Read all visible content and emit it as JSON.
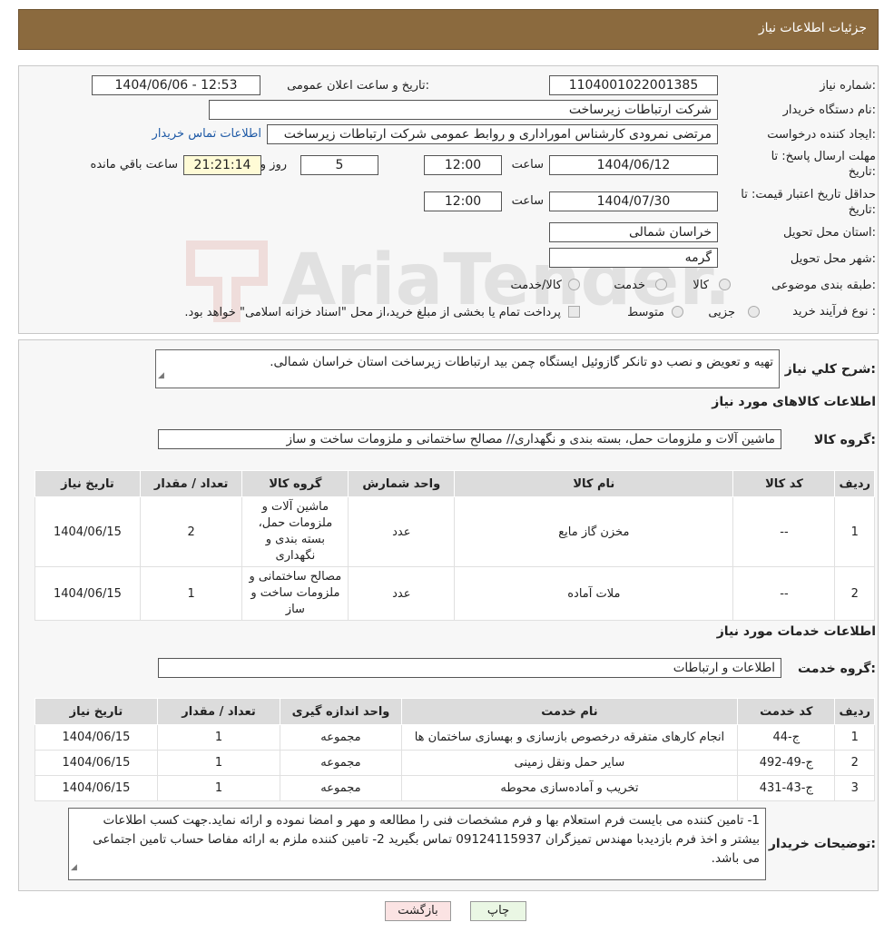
{
  "header": {
    "title": "جزئیات اطلاعات نیاز"
  },
  "need": {
    "number_label": "شماره نیاز:",
    "number": "1104001022001385",
    "announce_label": "تاریخ و ساعت اعلان عمومی:",
    "announce": "1404/06/06 - 12:53",
    "buyer_label": "نام دستگاه خریدار:",
    "buyer": "شرکت ارتباطات زیرساخت",
    "creator_label": "ایجاد کننده درخواست:",
    "creator": "مرتضی نمرودی کارشناس اموراداری و روابط عمومی شرکت ارتباطات زیرساخت",
    "contact_link": "اطلاعات تماس خریدار",
    "deadline_label_1": "مهلت ارسال پاسخ: تا",
    "deadline_label_2": "تاریخ:",
    "deadline_date": "1404/06/12",
    "time_label": "ساعت",
    "deadline_time": "12:00",
    "days": "5",
    "days_label": "روز و",
    "remaining": "21:21:14",
    "remaining_label": "ساعت باقي مانده",
    "validity_label_1": "حداقل تاریخ اعتبار قیمت: تا",
    "validity_label_2": "تاریخ:",
    "validity_date": "1404/07/30",
    "validity_time": "12:00",
    "province_label": "استان محل تحویل:",
    "province": "خراسان شمالی",
    "city_label": "شهر محل تحویل:",
    "city": "گرمه",
    "category_label": "طبقه بندی موضوعی:",
    "category_options": [
      "کالا",
      "خدمت",
      "کالا/خدمت"
    ],
    "process_label": "نوع فرآیند خرید :",
    "process_options": [
      "جزیی",
      "متوسط"
    ],
    "process_note": "پرداخت تمام یا بخشی از مبلغ خرید،از محل \"اسناد خزانه اسلامی\" خواهد بود."
  },
  "watermark": {
    "text": "AriaTender.neT"
  },
  "description": {
    "label": "شرح کلي نياز:",
    "text": "تهیه و تعویض و نصب دو تانکر گازوئیل ایستگاه چمن بید ارتباطات زیرساخت استان خراسان شمالی."
  },
  "goods": {
    "section_title": "اطلاعات کالاهای مورد نیاز",
    "group_label": "گروه کالا:",
    "group": "ماشین آلات و ملزومات حمل، بسته بندی و نگهداری// مصالح ساختمانی و ملزومات ساخت و ساز",
    "headers": [
      "ردیف",
      "کد کالا",
      "نام کالا",
      "واحد شمارش",
      "گروه کالا",
      "تعداد / مقدار",
      "تاریخ نیاز"
    ],
    "rows": [
      [
        "1",
        "--",
        "مخزن گاز مایع",
        "عدد",
        "ماشین آلات و ملزومات حمل، بسته بندی و نگهداری",
        "2",
        "1404/06/15"
      ],
      [
        "2",
        "--",
        "ملات آماده",
        "عدد",
        "مصالح ساختمانی و ملزومات ساخت و ساز",
        "1",
        "1404/06/15"
      ]
    ]
  },
  "services": {
    "section_title": "اطلاعات خدمات مورد نیاز",
    "group_label": "گروه خدمت:",
    "group": "اطلاعات و ارتباطات",
    "headers": [
      "ردیف",
      "کد خدمت",
      "نام خدمت",
      "واحد اندازه گیری",
      "تعداد / مقدار",
      "تاریخ نیاز"
    ],
    "rows": [
      [
        "1",
        "ج-44",
        "انجام کارهای متفرقه درخصوص بازسازی و بهسازی ساختمان ها",
        "مجموعه",
        "1",
        "1404/06/15"
      ],
      [
        "2",
        "ج-49-492",
        "سایر حمل ونقل زمینی",
        "مجموعه",
        "1",
        "1404/06/15"
      ],
      [
        "3",
        "ج-43-431",
        "تخریب و آماده‌سازی محوطه",
        "مجموعه",
        "1",
        "1404/06/15"
      ]
    ]
  },
  "notes": {
    "label": "توضیحات خریدار:",
    "text": "1- تامین کننده می بایست فرم استعلام بها و فرم مشخصات فنی را مطالعه و مهر و امضا نموده و ارائه نماید.جهت کسب اطلاعات بیشتر و اخذ فرم بازدیدبا مهندس تمیزگران 09124115937 تماس بگیرید 2- تامین کننده ملزم به ارائه مفاصا حساب تامین اجتماعی می باشد."
  },
  "buttons": {
    "print": "چاپ",
    "back": "بازگشت"
  }
}
